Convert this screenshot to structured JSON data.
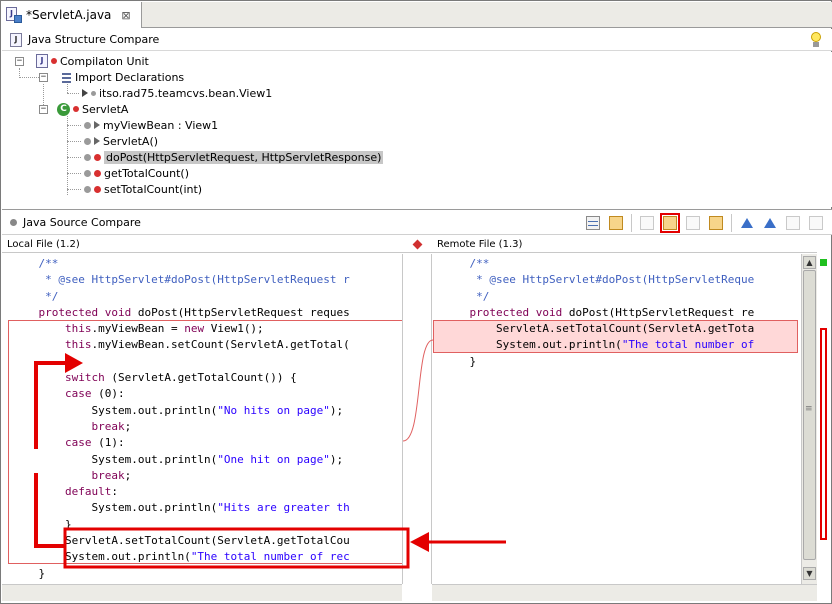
{
  "editor": {
    "tab_title": "*ServletA.java",
    "tab_close": "⊠"
  },
  "structure_compare": {
    "title": "Java Structure Compare",
    "tree": {
      "root": "Compilaton Unit",
      "imports_label": "Import Declarations",
      "import_item": "itso.rad75.teamcvs.bean.View1",
      "class_label": "ServletA",
      "members": [
        "myViewBean : View1",
        "ServletA()",
        "doPost(HttpServletRequest, HttpServletResponse)",
        "getTotalCount()",
        "setTotalCount(int)"
      ],
      "selected_member": "doPost(HttpServletRequest, HttpServletResponse)"
    }
  },
  "source_compare": {
    "title": "Java Source Compare",
    "left_title": "Local File (1.2)",
    "right_title": "Remote File (1.3)",
    "toolbar_icons": [
      "two-pane-icon",
      "swap-icon",
      "copy-all-left-icon",
      "copy-current-change-icon",
      "copy-all-right-icon",
      "copy-right-to-left-icon",
      "next-difference-icon",
      "previous-difference-icon",
      "next-change-icon",
      "previous-change-icon"
    ],
    "left_lines": [
      "    /**",
      "     * @see HttpServlet#doPost(HttpServletRequest r",
      "     */",
      "    protected void doPost(HttpServletRequest reques",
      "        this.myViewBean = new View1();",
      "        this.myViewBean.setCount(ServletA.getTotal(",
      "",
      "        switch (ServletA.getTotalCount()) {",
      "        case (0):",
      "            System.out.println(\"No hits on page\");",
      "            break;",
      "        case (1):",
      "            System.out.println(\"One hit on page\");",
      "            break;",
      "        default:",
      "            System.out.println(\"Hits are greater th",
      "        }",
      "        ServletA.setTotalCount(ServletA.getTotalCou",
      "        System.out.println(\"The total number of rec",
      "    }"
    ],
    "right_lines": [
      "    /**",
      "     * @see HttpServlet#doPost(HttpServletReque",
      "     */",
      "    protected void doPost(HttpServletRequest re",
      "        ServletA.setTotalCount(ServletA.getTota",
      "        System.out.println(\"The total number of",
      "    }"
    ],
    "scroll_arrows": {
      "up": "▲",
      "down": "▼",
      "grip": "≡"
    }
  },
  "colors": {
    "keyword": "#7f0055",
    "comment": "#3f5fbf",
    "string": "#2a00ff",
    "annotation": "#e30000",
    "diff_bg": "#ffd8d8"
  }
}
